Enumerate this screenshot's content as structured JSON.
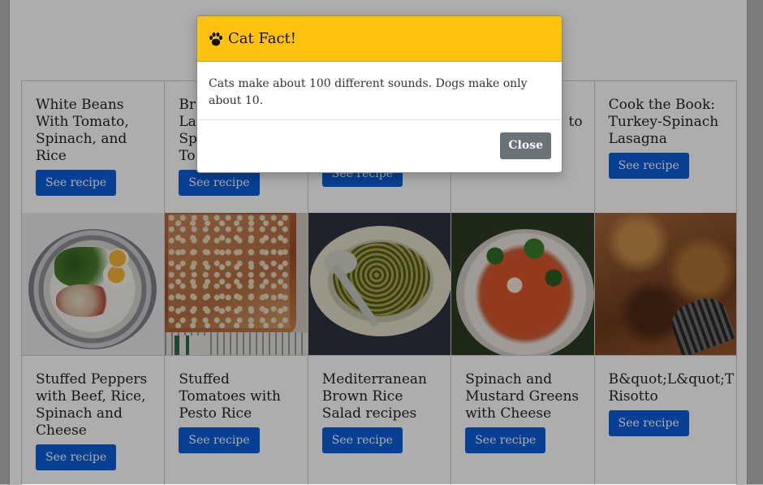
{
  "modal": {
    "icon": "paw-icon",
    "title": "Cat Fact!",
    "body": "Cats make about 100 different sounds. Dogs make only about 10.",
    "close_label": "Close"
  },
  "button_label": "See recipe",
  "recipes_top": [
    {
      "title": "White Beans\nWith Tomato,\nSpinach, and\nRice"
    },
    {
      "title": "Bro\nLas\nSpi\nTo"
    },
    {
      "title": ""
    },
    {
      "title": "to"
    },
    {
      "title": "Cook the Book:\nTurkey-Spinach\nLasagna"
    }
  ],
  "recipes_bottom": [
    {
      "title": "Stuffed Peppers\nwith Beef, Rice,\nSpinach and\nCheese"
    },
    {
      "title": "Stuffed\nTomatoes with\nPesto Rice"
    },
    {
      "title": "Mediterranean\nBrown Rice\nSalad recipes"
    },
    {
      "title": "Spinach and\nMustard Greens\nwith Cheese"
    },
    {
      "title": "B&quot;L&quot;T\nRisotto"
    }
  ],
  "colors": {
    "modal_header": "#fdc10e",
    "button": "#0b5ed7",
    "close_button": "#6b727a"
  }
}
